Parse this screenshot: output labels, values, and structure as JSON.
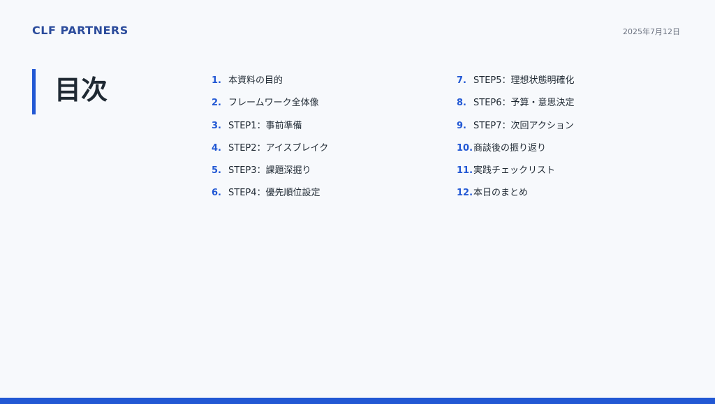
{
  "header": {
    "brand": "CLF PARTNERS",
    "date": "2025年7月12日"
  },
  "title": "目次",
  "toc": {
    "left": [
      {
        "num": "1.",
        "label": "本資料の目的"
      },
      {
        "num": "2.",
        "label": "フレームワーク全体像"
      },
      {
        "num": "3.",
        "label": "STEP1：事前準備"
      },
      {
        "num": "4.",
        "label": "STEP2：アイスブレイク"
      },
      {
        "num": "5.",
        "label": "STEP3：課題深掘り"
      },
      {
        "num": "6.",
        "label": "STEP4：優先順位設定"
      }
    ],
    "right": [
      {
        "num": "7.",
        "label": "STEP5：理想状態明確化"
      },
      {
        "num": "8.",
        "label": "STEP6：予算・意思決定"
      },
      {
        "num": "9.",
        "label": "STEP7：次回アクション"
      },
      {
        "num": "10.",
        "label": "商談後の振り返り"
      },
      {
        "num": "11.",
        "label": "実践チェックリスト"
      },
      {
        "num": "12.",
        "label": "本日のまとめ"
      }
    ]
  },
  "colors": {
    "accent": "#2258d4",
    "brand": "#2c4c9c",
    "background": "#f7f9fc"
  }
}
